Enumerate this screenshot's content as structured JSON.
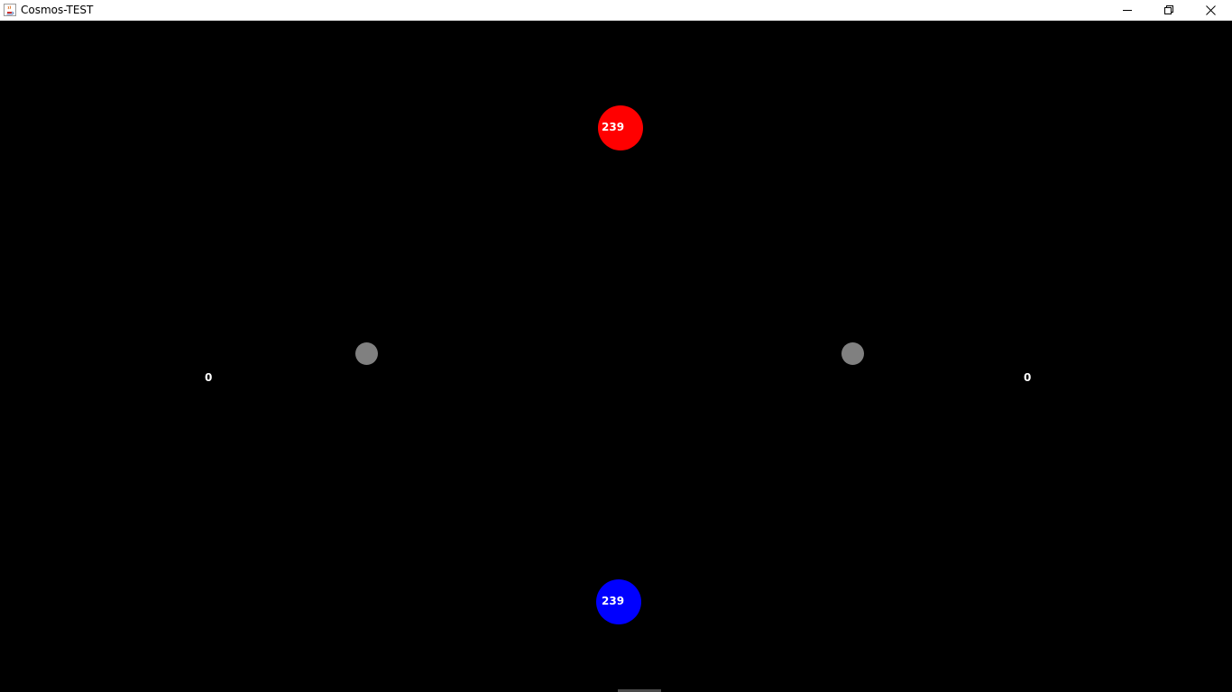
{
  "window": {
    "title": "Cosmos-TEST",
    "icons": {
      "app": "java-cup-icon",
      "minimize": "minimize-icon",
      "maximize": "restore-icon",
      "close": "close-icon"
    }
  },
  "game": {
    "background_color": "#000000",
    "planets": {
      "red": {
        "units": "239",
        "color": "#ff0000"
      },
      "blue": {
        "units": "239",
        "color": "#0000ff"
      },
      "neutral_left": {
        "color": "#808080"
      },
      "neutral_right": {
        "color": "#808080"
      }
    },
    "scores": {
      "left": "0",
      "right": "0"
    }
  }
}
